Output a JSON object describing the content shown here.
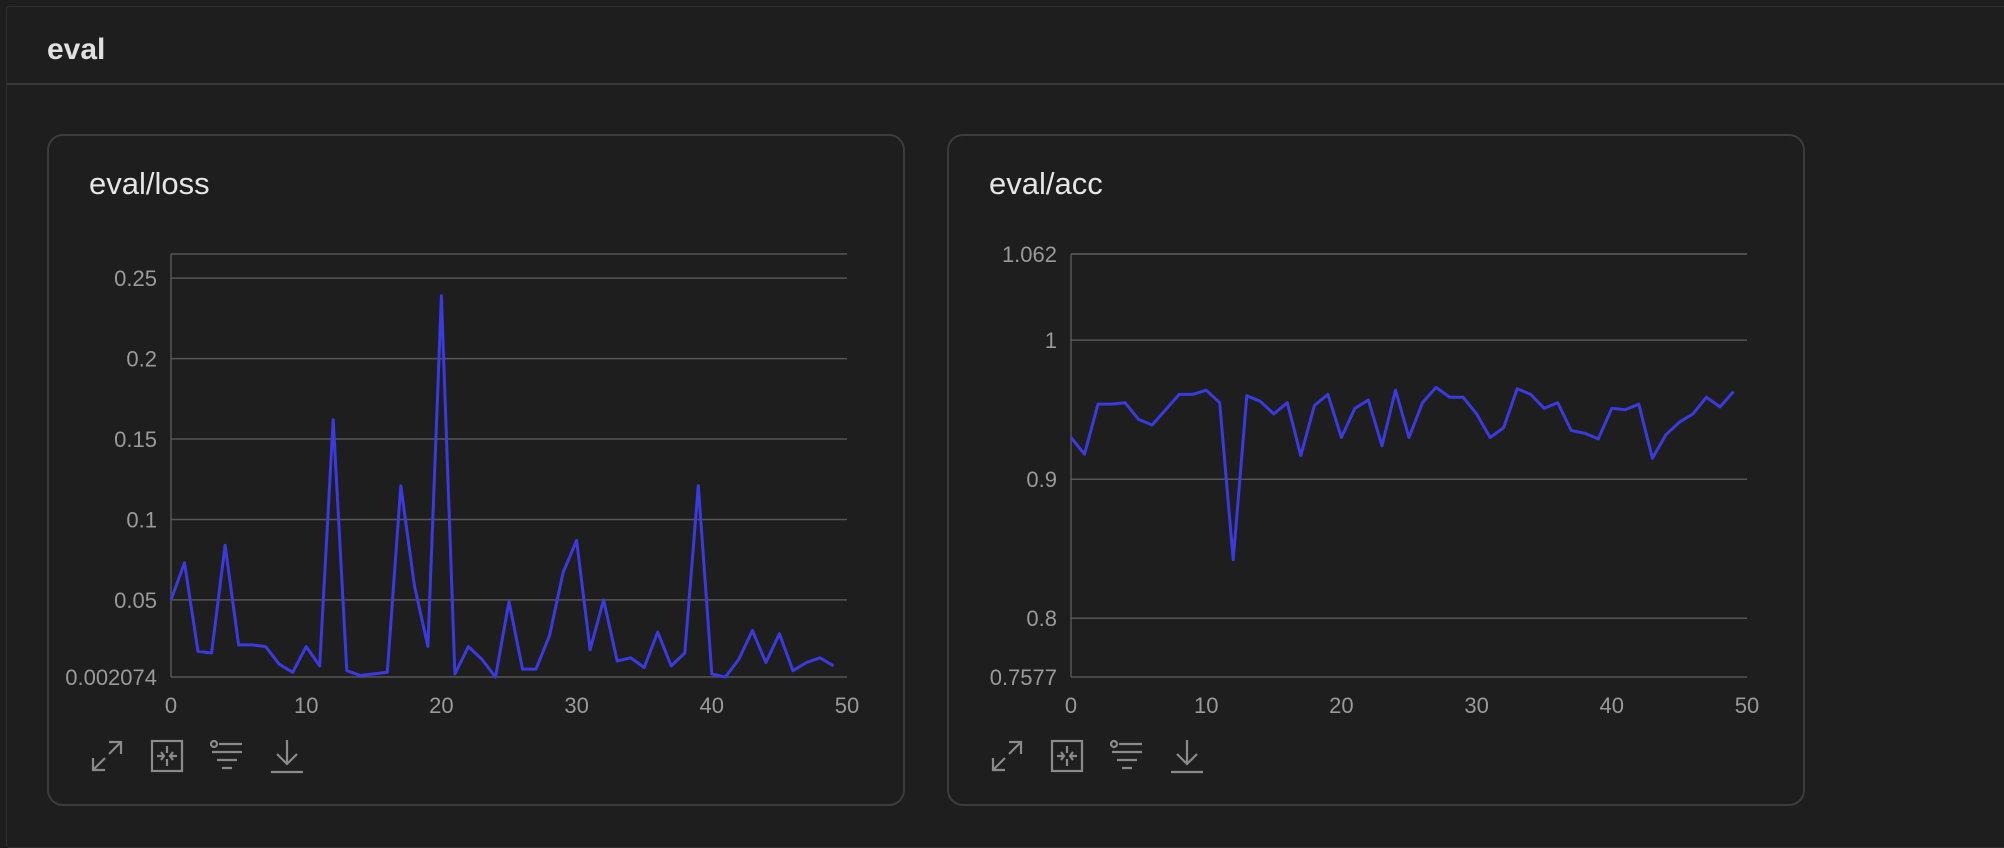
{
  "section": {
    "title": "eval"
  },
  "panels": [
    {
      "title": "eval/loss"
    },
    {
      "title": "eval/acc"
    }
  ],
  "toolbar_icons": [
    "expand-icon",
    "fit-icon",
    "filter-icon",
    "download-icon"
  ],
  "colors": {
    "line": "#3a3ae0",
    "grid": "#555555",
    "background": "#1e1e1e"
  },
  "chart_data": [
    {
      "type": "line",
      "title": "eval/loss",
      "xlim": [
        0,
        50
      ],
      "ylim": [
        0.002074,
        0.265
      ],
      "xticks": [
        "0",
        "10",
        "20",
        "30",
        "40",
        "50"
      ],
      "xtick_values": [
        0,
        10,
        20,
        30,
        40,
        50
      ],
      "yticks": [
        "0.002074",
        "0.05",
        "0.1",
        "0.15",
        "0.2",
        "0.25"
      ],
      "ytick_values": [
        0.002074,
        0.05,
        0.1,
        0.15,
        0.2,
        0.25
      ],
      "grid": true,
      "series": [
        {
          "x": [
            0,
            1,
            2,
            3,
            4,
            5,
            6,
            7,
            8,
            9,
            10,
            11,
            12,
            13,
            14,
            15,
            16,
            17,
            18,
            19,
            20,
            21,
            22,
            23,
            24,
            25,
            26,
            27,
            28,
            29,
            30,
            31,
            32,
            33,
            34,
            35,
            36,
            37,
            38,
            39,
            40,
            41,
            42,
            43,
            44,
            45,
            46,
            47,
            48,
            49
          ],
          "y": [
            0.05,
            0.073,
            0.018,
            0.017,
            0.084,
            0.022,
            0.022,
            0.021,
            0.01,
            0.005,
            0.021,
            0.009,
            0.162,
            0.006,
            0.003,
            0.004,
            0.005,
            0.121,
            0.059,
            0.021,
            0.239,
            0.004,
            0.021,
            0.013,
            0.002,
            0.049,
            0.007,
            0.007,
            0.028,
            0.067,
            0.087,
            0.019,
            0.05,
            0.012,
            0.014,
            0.008,
            0.03,
            0.009,
            0.017,
            0.121,
            0.004,
            0.002,
            0.013,
            0.031,
            0.011,
            0.029,
            0.006,
            0.011,
            0.014,
            0.009
          ]
        }
      ]
    },
    {
      "type": "line",
      "title": "eval/acc",
      "xlim": [
        0,
        50
      ],
      "ylim": [
        0.7577,
        1.062
      ],
      "xticks": [
        "0",
        "10",
        "20",
        "30",
        "40",
        "50"
      ],
      "xtick_values": [
        0,
        10,
        20,
        30,
        40,
        50
      ],
      "yticks": [
        "0.7577",
        "0.8",
        "0.9",
        "1",
        "1.062"
      ],
      "ytick_values": [
        0.7577,
        0.8,
        0.9,
        1,
        1.062
      ],
      "grid": true,
      "series": [
        {
          "x": [
            0,
            1,
            2,
            3,
            4,
            5,
            6,
            7,
            8,
            9,
            10,
            11,
            12,
            13,
            14,
            15,
            16,
            17,
            18,
            19,
            20,
            21,
            22,
            23,
            24,
            25,
            26,
            27,
            28,
            29,
            30,
            31,
            32,
            33,
            34,
            35,
            36,
            37,
            38,
            39,
            40,
            41,
            42,
            43,
            44,
            45,
            46,
            47,
            48,
            49
          ],
          "y": [
            0.93,
            0.918,
            0.954,
            0.954,
            0.955,
            0.943,
            0.939,
            0.95,
            0.961,
            0.961,
            0.964,
            0.955,
            0.842,
            0.96,
            0.956,
            0.947,
            0.955,
            0.917,
            0.953,
            0.961,
            0.93,
            0.951,
            0.957,
            0.924,
            0.964,
            0.93,
            0.955,
            0.966,
            0.959,
            0.959,
            0.947,
            0.93,
            0.937,
            0.965,
            0.961,
            0.951,
            0.955,
            0.935,
            0.933,
            0.929,
            0.951,
            0.95,
            0.954,
            0.915,
            0.932,
            0.941,
            0.947,
            0.959,
            0.952,
            0.963
          ]
        }
      ]
    }
  ]
}
